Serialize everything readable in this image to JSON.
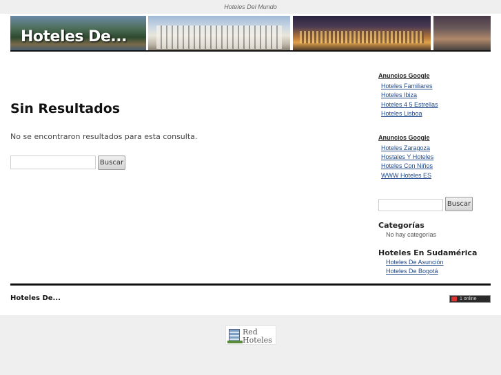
{
  "top_bar": {
    "site_name": "Hoteles Del Mundo"
  },
  "header": {
    "title": "Hoteles De..."
  },
  "main": {
    "title": "Sin Resultados",
    "message": "No se encontraron resultados para esta consulta.",
    "search": {
      "value": "",
      "button_label": "Buscar"
    }
  },
  "sidebar": {
    "ad_block_1": {
      "heading": "Anuncios Google",
      "links": [
        "Hoteles Familiares",
        "Hoteles Ibiza",
        "Hoteles 4 5 Estrellas",
        "Hoteles Lisboa"
      ]
    },
    "ad_block_2": {
      "heading": "Anuncios Google",
      "links": [
        "Hoteles Zaragoza",
        "Hostales Y Hoteles",
        "Hoteles Con Niños",
        "WWW Hoteles ES"
      ]
    },
    "search": {
      "value": "",
      "button_label": "Buscar"
    },
    "categories": {
      "heading": "Categorías",
      "empty_text": "No hay categorías"
    },
    "sudamerica": {
      "heading": "Hoteles En Sudamérica",
      "links": [
        "Hoteles De Asunción",
        "Hoteles De Bogotá"
      ]
    }
  },
  "footer": {
    "title": "Hoteles De...",
    "counter": {
      "count": "1",
      "label": "online"
    },
    "logo": {
      "line1": "Red",
      "line2": "Hoteles"
    }
  },
  "colors": {
    "link": "#224a8a",
    "background": "#efefef",
    "divider": "#111111"
  }
}
